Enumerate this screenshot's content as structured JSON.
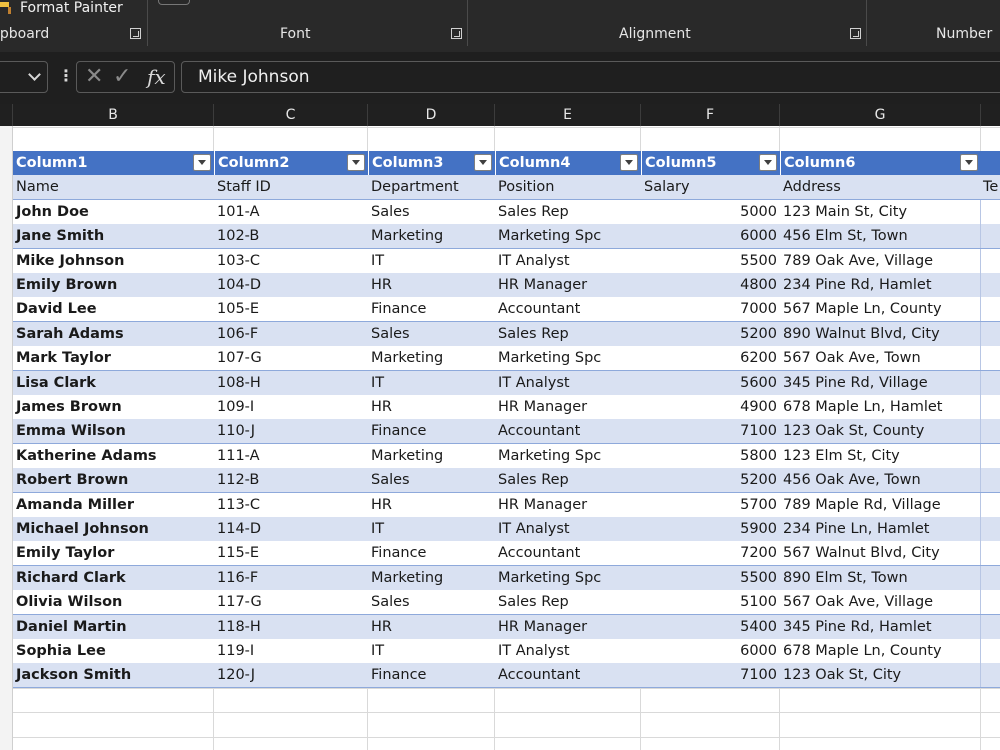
{
  "ribbon": {
    "format_painter": "Format Painter",
    "groups": [
      "ipboard",
      "Font",
      "Alignment",
      "Number"
    ]
  },
  "formula_bar": {
    "fx_label": "fx",
    "cancel_symbol": "✕",
    "enter_symbol": "✓",
    "value": "Mike Johnson"
  },
  "columns": [
    "B",
    "C",
    "D",
    "E",
    "F",
    "G"
  ],
  "table": {
    "headers": [
      "Column1",
      "Column2",
      "Column3",
      "Column4",
      "Column5",
      "Column6"
    ],
    "field_row": [
      "Name",
      "Staff ID",
      "Department",
      "Position",
      "Salary",
      "Address",
      "Te"
    ],
    "rows": [
      [
        "John Doe",
        "101-A",
        "Sales",
        "Sales Rep",
        "5000",
        "123 Main St, City"
      ],
      [
        "Jane Smith",
        "102-B",
        "Marketing",
        "Marketing Spc",
        "6000",
        "456 Elm St, Town"
      ],
      [
        "Mike Johnson",
        "103-C",
        "IT",
        "IT Analyst",
        "5500",
        "789 Oak Ave, Village"
      ],
      [
        "Emily Brown",
        "104-D",
        "HR",
        "HR Manager",
        "4800",
        "234 Pine Rd, Hamlet"
      ],
      [
        "David Lee",
        "105-E",
        "Finance",
        "Accountant",
        "7000",
        "567 Maple Ln, County"
      ],
      [
        "Sarah Adams",
        "106-F",
        "Sales",
        "Sales Rep",
        "5200",
        "890 Walnut Blvd, City"
      ],
      [
        "Mark Taylor",
        "107-G",
        "Marketing",
        "Marketing Spc",
        "6200",
        "567 Oak Ave, Town"
      ],
      [
        "Lisa Clark",
        "108-H",
        "IT",
        "IT Analyst",
        "5600",
        "345 Pine Rd, Village"
      ],
      [
        "James Brown",
        "109-I",
        "HR",
        "HR Manager",
        "4900",
        "678 Maple Ln, Hamlet"
      ],
      [
        "Emma Wilson",
        "110-J",
        "Finance",
        "Accountant",
        "7100",
        "123 Oak St, County"
      ],
      [
        "Katherine Adams",
        "111-A",
        "Marketing",
        "Marketing Spc",
        "5800",
        "123 Elm St, City"
      ],
      [
        "Robert Brown",
        "112-B",
        "Sales",
        "Sales Rep",
        "5200",
        "456 Oak Ave, Town"
      ],
      [
        "Amanda Miller",
        "113-C",
        "HR",
        "HR Manager",
        "5700",
        "789 Maple Rd, Village"
      ],
      [
        "Michael Johnson",
        "114-D",
        "IT",
        "IT Analyst",
        "5900",
        "234 Pine Ln, Hamlet"
      ],
      [
        "Emily Taylor",
        "115-E",
        "Finance",
        "Accountant",
        "7200",
        "567 Walnut Blvd, City"
      ],
      [
        "Richard Clark",
        "116-F",
        "Marketing",
        "Marketing Spc",
        "5500",
        "890 Elm St, Town"
      ],
      [
        "Olivia Wilson",
        "117-G",
        "Sales",
        "Sales Rep",
        "5100",
        "567 Oak Ave, Village"
      ],
      [
        "Daniel Martin",
        "118-H",
        "HR",
        "HR Manager",
        "5400",
        "345 Pine Rd, Hamlet"
      ],
      [
        "Sophia Lee",
        "119-I",
        "IT",
        "IT Analyst",
        "6000",
        "678 Maple Ln, County"
      ],
      [
        "Jackson Smith",
        "120-J",
        "Finance",
        "Accountant",
        "7100",
        "123 Oak St, City"
      ]
    ]
  },
  "colors": {
    "ribbon_bg": "#292929",
    "header_row": "#4472c4",
    "band_row": "#d9e1f2"
  }
}
